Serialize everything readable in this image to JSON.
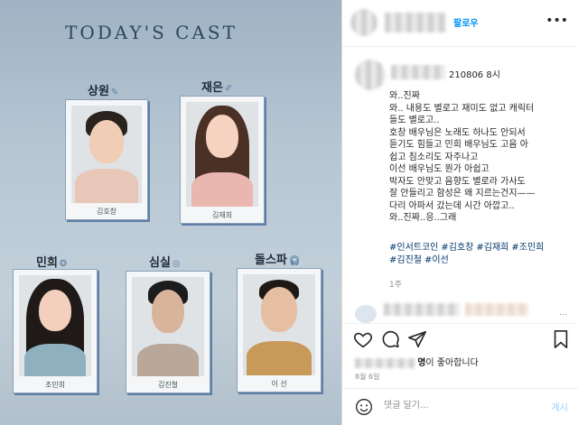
{
  "board": {
    "title": "TODAY'S CAST",
    "cast": [
      {
        "role": "상원",
        "name": "김호창"
      },
      {
        "role": "재은",
        "name": "김재희"
      },
      {
        "role": "민희",
        "name": "조민희"
      },
      {
        "role": "심실",
        "name": "김진철"
      },
      {
        "role": "돌스파",
        "name": "이 선"
      }
    ]
  },
  "header": {
    "follow_label": "팔로우",
    "more_icon": "more-horizontal-icon"
  },
  "caption": {
    "date": "210806 8시",
    "lines": [
      "와..진짜",
      "와.. 내용도 별로고 재미도 없고 캐릭터",
      "들도 별로고..",
      "호창 배우님은 노래도 하나도 안되서",
      "듣기도 힘들고 민희 배우님도 고음 아",
      "쉽고 침소리도 자주나고",
      "이선 배우님도 뭔가 아쉽고",
      "박자도 안맞고 음향도 별로라 가사도",
      "잘 안들리고 함성은 왜 지르는건지——",
      "다리 아파서 갔는데 시간 아깝고..",
      "와..진짜..응..그래"
    ],
    "hashtags": [
      "#인서트코인",
      "#김호창",
      "#김재희",
      "#조민희",
      "#김진철",
      "#이선"
    ],
    "time_ago": "1주"
  },
  "comments": {
    "more_label": "…"
  },
  "likes": {
    "count_suffix": "명",
    "text": "이 좋아합니다"
  },
  "post_date": "8월 6일",
  "comment_bar": {
    "placeholder": "댓글 달기...",
    "post_label": "게시"
  },
  "colors": {
    "link": "#0095f6",
    "hashtag": "#00376b",
    "muted": "#8e8e8e",
    "board_blue": "#5f7fa6"
  }
}
